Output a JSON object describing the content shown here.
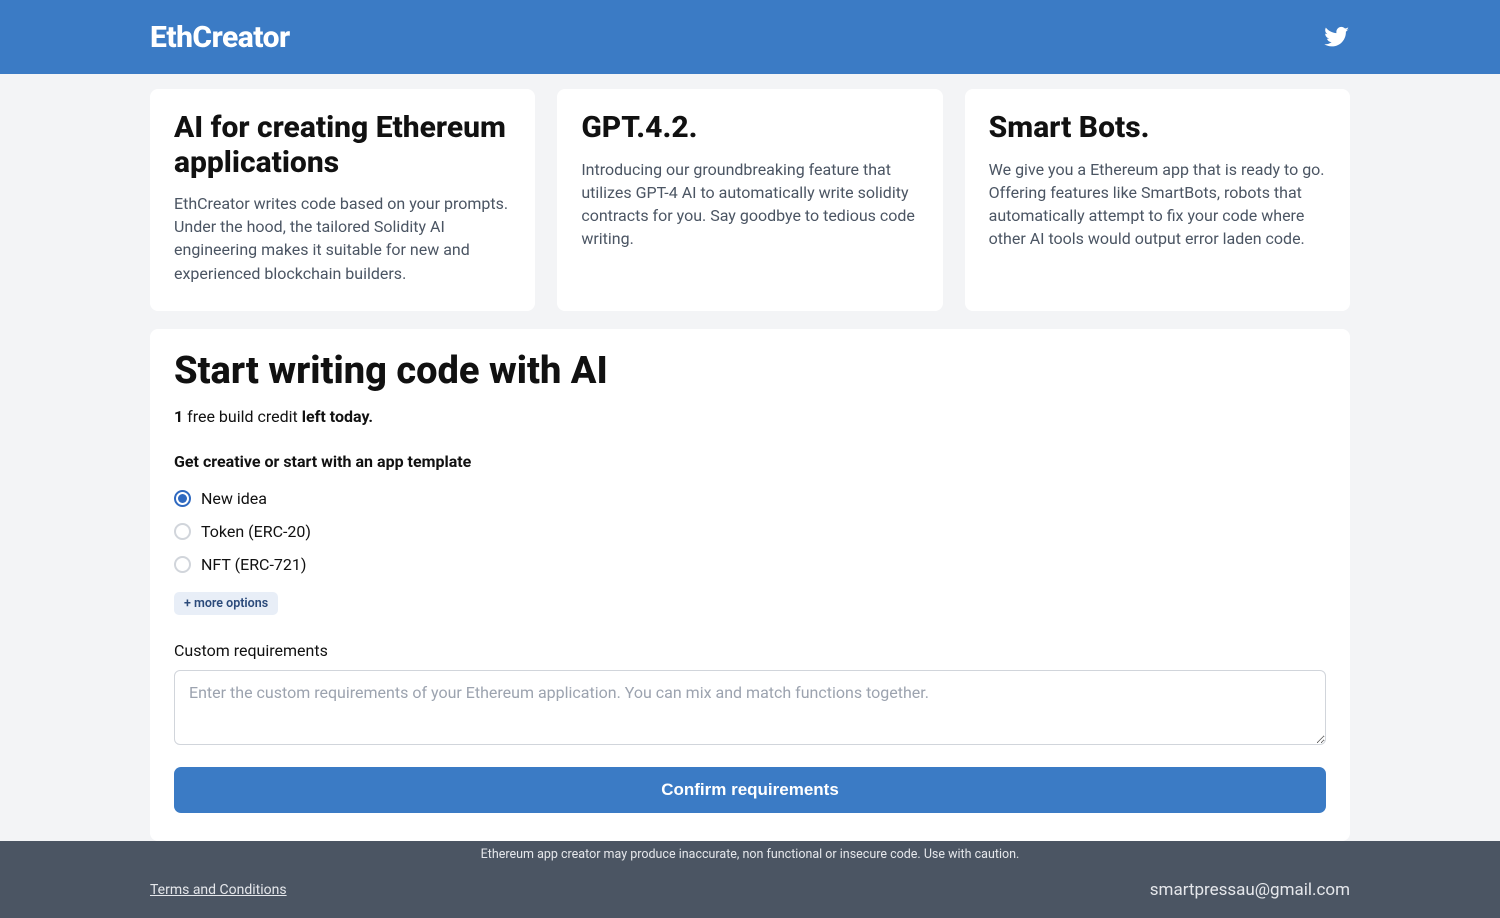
{
  "header": {
    "brand": "EthCreator"
  },
  "cards": [
    {
      "title": "AI for creating Ethereum applications",
      "body": "EthCreator writes code based on your prompts. Under the hood, the tailored Solidity AI engineering makes it suitable for new and experienced blockchain builders."
    },
    {
      "title": "GPT.4.2.",
      "body": "Introducing our groundbreaking feature that utilizes GPT-4 AI to automatically write solidity contracts for you. Say goodbye to tedious code writing."
    },
    {
      "title": "Smart Bots.",
      "body": "We give you a Ethereum app that is ready to go. Offering features like SmartBots, robots that automatically attempt to fix your code where other AI tools would output error laden code."
    }
  ],
  "panel": {
    "heading": "Start writing code with AI",
    "credits": {
      "count": "1",
      "mid": " free build credit ",
      "suffix": "left today."
    },
    "template_prompt": "Get creative or start with an app template",
    "options": [
      {
        "label": "New idea",
        "selected": true
      },
      {
        "label": "Token (ERC-20)",
        "selected": false
      },
      {
        "label": "NFT (ERC-721)",
        "selected": false
      }
    ],
    "more_options": "+ more options",
    "custom_label": "Custom requirements",
    "custom_placeholder": "Enter the custom requirements of your Ethereum application. You can mix and match functions together.",
    "confirm": "Confirm requirements"
  },
  "footer": {
    "disclaimer": "Ethereum app creator may produce inaccurate, non functional or insecure code. Use with caution.",
    "terms": "Terms and Conditions",
    "email": "smartpressau@gmail.com"
  }
}
